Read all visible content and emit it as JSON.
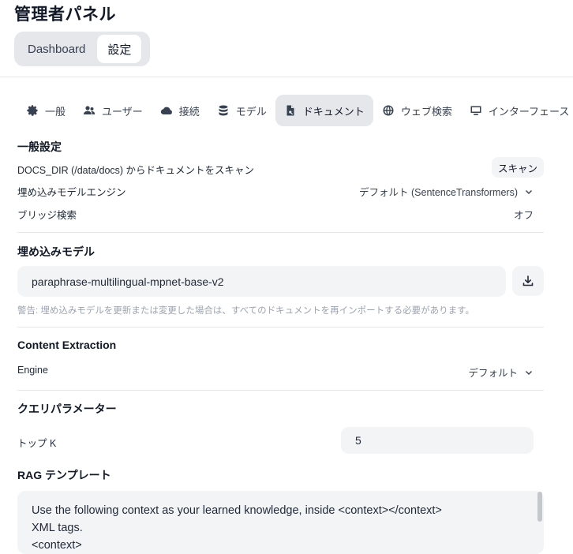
{
  "page": {
    "title": "管理者パネル"
  },
  "top_tabs": [
    {
      "label": "Dashboard"
    },
    {
      "label": "設定"
    }
  ],
  "settings_tabs": [
    {
      "label": "一般",
      "icon": "gear-icon"
    },
    {
      "label": "ユーザー",
      "icon": "users-icon"
    },
    {
      "label": "接続",
      "icon": "cloud-icon"
    },
    {
      "label": "モデル",
      "icon": "database-icon"
    },
    {
      "label": "ドキュメント",
      "icon": "document-icon"
    },
    {
      "label": "ウェブ検索",
      "icon": "globe-icon"
    },
    {
      "label": "インターフェース",
      "icon": "monitor-icon"
    }
  ],
  "general": {
    "title": "一般設定",
    "scan_label": "DOCS_DIR (/data/docs) からドキュメントをスキャン",
    "scan_button": "スキャン",
    "embed_engine_label": "埋め込みモデルエンジン",
    "embed_engine_value": "デフォルト (SentenceTransformers)",
    "bridge_label": "ブリッジ検索",
    "bridge_value": "オフ"
  },
  "embedding": {
    "title": "埋め込みモデル",
    "model_value": "paraphrase-multilingual-mpnet-base-v2",
    "warning": "警告: 埋め込みモデルを更新または変更した場合は、すべてのドキュメントを再インポートする必要があります。"
  },
  "content_extraction": {
    "title": "Content Extraction",
    "engine_label": "Engine",
    "engine_value": "デフォルト"
  },
  "query_params": {
    "title": "クエリパラメーター",
    "topk_label": "トップ K",
    "topk_value": "5"
  },
  "rag": {
    "title": "RAG テンプレート",
    "lines": [
      "Use the following context as your learned knowledge, inside <context></context>",
      "XML tags.",
      "<context>"
    ]
  }
}
